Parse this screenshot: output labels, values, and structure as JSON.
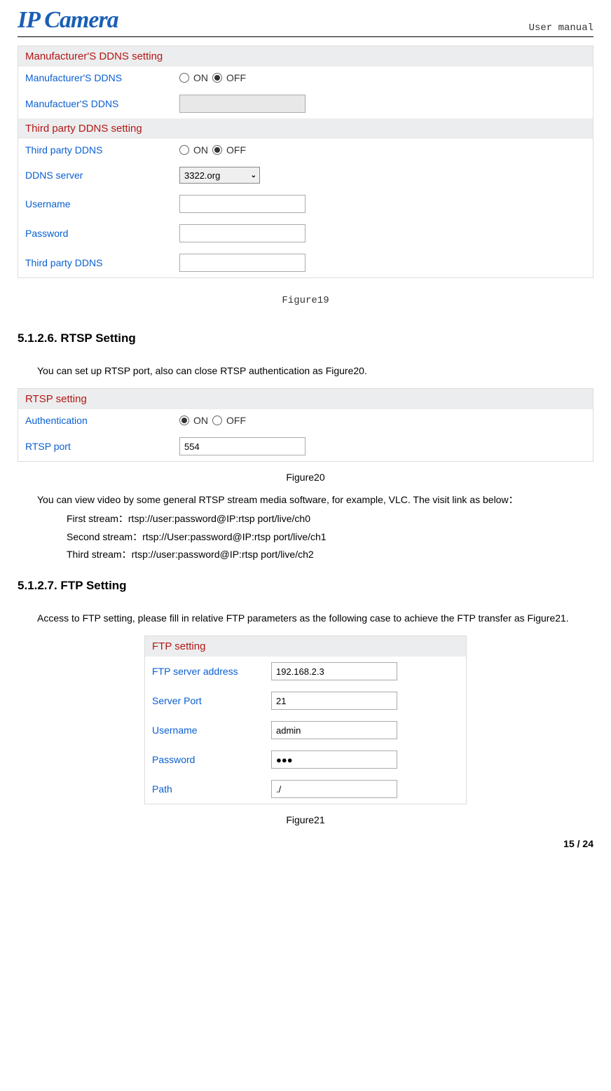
{
  "header": {
    "logo": "IP Camera",
    "doc_title": "User manual"
  },
  "ddns_panel": {
    "section1_title": "Manufacturer'S DDNS setting",
    "mfr_ddns_label": "Manufacturer'S DDNS",
    "on": "ON",
    "off": "OFF",
    "mfr_ddns2_label": "Manufactuer'S DDNS",
    "section2_title": "Third party DDNS setting",
    "tp_ddns_label": "Third party DDNS",
    "server_label": "DDNS server",
    "server_value": "3322.org",
    "username_label": "Username",
    "password_label": "Password",
    "tp_ddns2_label": "Third party DDNS"
  },
  "figure19": "Figure19",
  "rtsp": {
    "heading": "5.1.2.6. RTSP Setting",
    "intro": "You can set up RTSP port, also can close RTSP authentication as Figure20.",
    "panel_title": "RTSP setting",
    "auth_label": "Authentication",
    "on": "ON",
    "off": "OFF",
    "port_label": "RTSP port",
    "port_value": "554",
    "figure": "Figure20",
    "desc": "You can view video by some general RTSP stream media software, for example, VLC. The visit link as below：",
    "stream1": "First stream：rtsp://user:password@IP:rtsp port/live/ch0",
    "stream2": "Second stream：rtsp://User:password@IP:rtsp port/live/ch1",
    "stream3": "Third stream：rtsp://user:password@IP:rtsp port/live/ch2"
  },
  "ftp": {
    "heading": "5.1.2.7. FTP Setting",
    "intro": "Access to FTP setting, please fill in relative FTP parameters as the following case to achieve the FTP transfer as Figure21.",
    "panel_title": "FTP setting",
    "addr_label": "FTP server address",
    "addr_value": "192.168.2.3",
    "port_label": "Server Port",
    "port_value": "21",
    "user_label": "Username",
    "user_value": "admin",
    "pass_label": "Password",
    "pass_value": "●●●",
    "path_label": "Path",
    "path_value": "./",
    "figure": "Figure21"
  },
  "page_num": "15 / 24"
}
